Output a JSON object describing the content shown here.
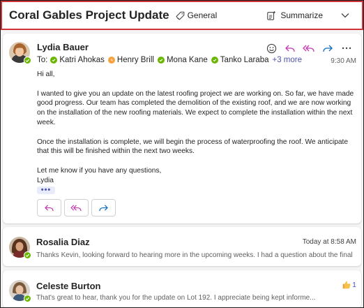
{
  "header": {
    "subject": "Coral Gables Project Update",
    "tag_label": "General",
    "summarize_label": "Summarize"
  },
  "messages": [
    {
      "sender": "Lydia Bauer",
      "to_label": "To:",
      "recipients": [
        "Katri Ahokas",
        "Henry Brill",
        "Mona Kane",
        "Tanko Laraba"
      ],
      "more_recipients": "+3 more",
      "time": "9:30 AM",
      "body": [
        "Hi all,",
        "I wanted to give you an update on the latest roofing project we are working on. So far, we have made good progress. Our team has completed the demolition of the existing roof, and we are now working on the installation of the new roofing materials. We expect to complete the installation within the next week.",
        "Once the installation is complete, we will begin the process of waterproofing the roof. We anticipate that this will be finished within the next two weeks.",
        "Let me know if you have any questions,",
        "Lydia"
      ],
      "ellipsis": "•••"
    },
    {
      "sender": "Rosalia Diaz",
      "time": "Today at 8:58 AM",
      "preview": "Thanks Kevin, looking forward to hearing more in the upcoming weeks. I had a question about the final cost fo..."
    },
    {
      "sender": "Celeste Burton",
      "reaction_count": "1",
      "preview": "That's great to hear, thank you for the update on Lot 192. I appreciate being kept informe..."
    }
  ],
  "icons": {
    "tag": "tag-icon",
    "summarize": "summarize-sparkle-icon",
    "collapse": "chevron-down-icon",
    "emoji": "emoji-icon",
    "reply": "reply-icon",
    "reply_all": "reply-all-icon",
    "forward": "forward-icon",
    "more": "more-icon",
    "reaction": "thumbs-up-icon"
  },
  "colors": {
    "accent": "#4f52b2",
    "reply_icon": "#c239b3",
    "forward_icon": "#0f6cbd",
    "presence_available": "#6bb700",
    "presence_away": "#f7a23c",
    "highlight_border": "#d13438"
  }
}
